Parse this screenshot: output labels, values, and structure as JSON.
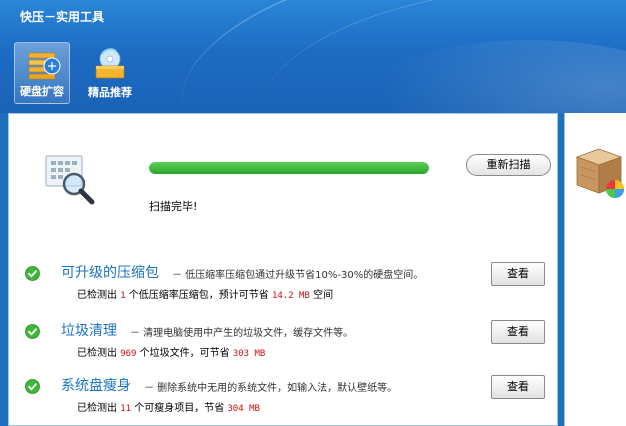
{
  "app": {
    "title": "快压－实用工具"
  },
  "nav": [
    {
      "label": "硬盘扩容",
      "icon": "disk-expand-icon",
      "active": true
    },
    {
      "label": "精品推荐",
      "icon": "disc-recommend-icon",
      "active": false
    }
  ],
  "scan": {
    "status": "扫描完毕!",
    "progress": 1.0,
    "rescan_label": "重新扫描"
  },
  "items": [
    {
      "title": "可升级的压缩包",
      "desc": "－ 低压缩率压缩包通过升级节省10%-30%的硬盘空间。",
      "detail_pre": "已检测出 ",
      "count": "1",
      "detail_mid": " 个低压缩率压缩包，预计可节省 ",
      "size": "14.2 MB",
      "detail_post": " 空间",
      "button": "查看"
    },
    {
      "title": "垃圾清理",
      "desc": "－ 清理电脑使用中产生的垃圾文件，缓存文件等。",
      "detail_pre": "已检测出 ",
      "count": "969",
      "detail_mid": " 个垃圾文件，可节省 ",
      "size": "303 MB",
      "detail_post": "",
      "button": "查看"
    },
    {
      "title": "系统盘瘦身",
      "desc": "－ 删除系统中无用的系统文件，如输入法，默认壁纸等。",
      "detail_pre": "已检测出 ",
      "count": "11",
      "detail_mid": " 个可瘦身项目，节省 ",
      "size": "304 MB",
      "detail_post": "",
      "button": "查看"
    }
  ],
  "colors": {
    "header": "#1d6cc3",
    "accent_title": "#1a74c4",
    "progress": "#2aa52a",
    "highlight_number": "#d01010"
  }
}
